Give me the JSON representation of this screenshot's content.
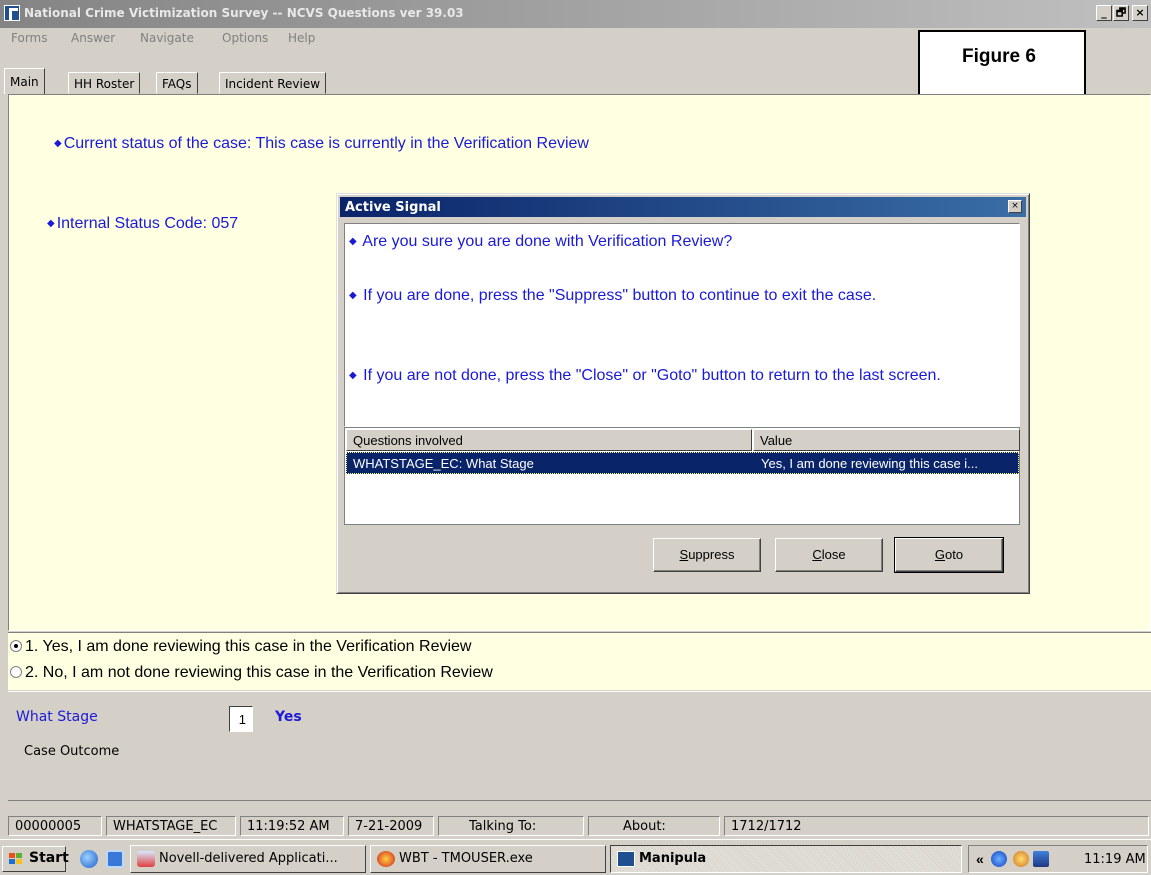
{
  "window": {
    "title": "National Crime Victimization Survey -- NCVS Questions ver 39.03",
    "controls": [
      "_",
      "🗗",
      "×"
    ]
  },
  "menu": [
    "Forms",
    "Answer",
    "Navigate",
    "Options",
    "Help"
  ],
  "figure_label": "Figure 6",
  "tabs": [
    {
      "label": "Main",
      "active": true
    },
    {
      "label": "HH Roster",
      "active": false
    },
    {
      "label": "FAQs",
      "active": false
    },
    {
      "label": "Incident Review",
      "active": false
    }
  ],
  "main": {
    "status_line": "Current status of the case: This case is currently in the Verification Review",
    "internal_code": "Internal Status Code: 057"
  },
  "dialog": {
    "title": "Active Signal",
    "close_glyph": "×",
    "messages": [
      "Are you sure you are done with Verification Review?",
      "If you are done, press the \"Suppress\" button to continue to exit the case.",
      "If you are not done, press the \"Close\" or \"Goto\" button to return to the last screen."
    ],
    "grid": {
      "headers": [
        "Questions involved",
        "Value"
      ],
      "rows": [
        {
          "question": "WHATSTAGE_EC: What Stage",
          "value": "Yes, I am done reviewing this case i..."
        }
      ]
    },
    "buttons": {
      "suppress": {
        "accel": "S",
        "rest": "uppress"
      },
      "close": {
        "accel": "C",
        "rest": "lose"
      },
      "goto": {
        "accel": "G",
        "rest": "oto"
      }
    }
  },
  "answers": [
    {
      "text": "1. Yes, I am done reviewing this case in the Verification Review",
      "selected": true
    },
    {
      "text": "2. No, I am not done reviewing this case in the Verification Review",
      "selected": false
    }
  ],
  "info": {
    "field_label": "What Stage",
    "field_value": "1",
    "field_value_text": "Yes",
    "description": "Case Outcome"
  },
  "statusbar": [
    "00000005",
    "WHATSTAGE_EC",
    "11:19:52 AM",
    "7-21-2009",
    "Talking To:",
    "About:",
    "1712/1712"
  ],
  "taskbar": {
    "start": "Start",
    "tasks": [
      {
        "label": "Novell-delivered Applicati...",
        "active": false
      },
      {
        "label": "WBT - TMOUSER.exe",
        "active": false
      },
      {
        "label": "Manipula",
        "active": true
      }
    ],
    "tray_chevron": "«",
    "clock": "11:19 AM"
  },
  "colors": {
    "panel_yellow": "#ffffe1",
    "prompt_blue": "#1a1ad8",
    "selection_navy": "#0a246a"
  }
}
